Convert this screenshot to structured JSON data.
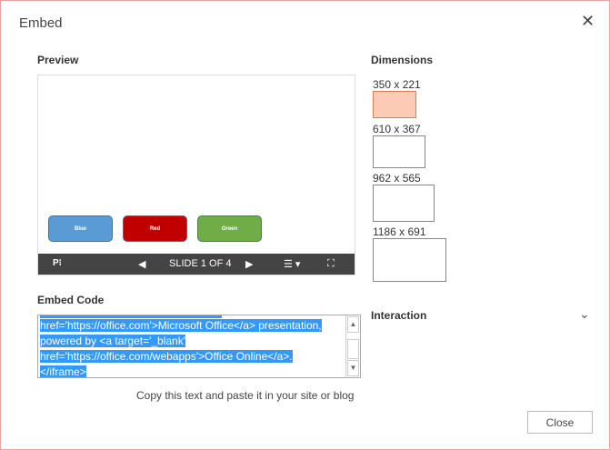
{
  "dialog": {
    "title": "Embed",
    "close_icon": "close-icon"
  },
  "preview": {
    "label": "Preview",
    "slide_buttons": [
      {
        "label": "Blue",
        "color": "#5b9bd5"
      },
      {
        "label": "Red",
        "color": "#c00000"
      },
      {
        "label": "Green",
        "color": "#70ad47"
      }
    ],
    "slide_counter": "SLIDE 1 OF 4"
  },
  "dimensions": {
    "label": "Dimensions",
    "options": [
      {
        "label": "350 x 221",
        "selected": true
      },
      {
        "label": "610 x 367"
      },
      {
        "label": "962 x 565"
      },
      {
        "label": "1186 x 691"
      }
    ]
  },
  "embed_code": {
    "label": "Embed Code",
    "lines": [
      "href='https://office.com'>Microsoft Office</a> presentation,",
      "powered by <a target='_blank'",
      "href='https://office.com/webapps'>Office Online</a>.",
      "</iframe>"
    ],
    "caption": "Copy this text and paste it in your site or blog"
  },
  "interaction": {
    "label": "Interaction"
  },
  "footer": {
    "close_label": "Close"
  },
  "colors": {
    "selected_fill": "#fccbb5",
    "selected_border": "#e07a5f",
    "toolbar": "#444444"
  }
}
